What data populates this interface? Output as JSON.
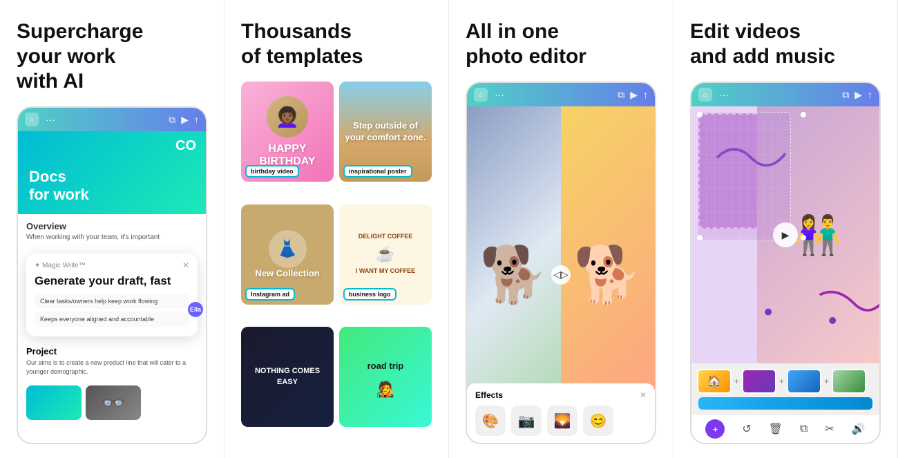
{
  "panel1": {
    "title_line1": "Supercharge",
    "title_line2": "your work",
    "title_line3": "with AI",
    "hero_text": "Docs\nfor work",
    "hero_logo": "CO",
    "overview_title": "Overview",
    "overview_text": "When working with your team, it's important",
    "magic_write_label": "✦ Magic Write™",
    "magic_write_title": "Generate your draft, fast",
    "ella_label": "Ella",
    "suggestion1": "Clear tasks/owners help keep work flowing",
    "suggestion2": "Keeps everyone aligned and accountable",
    "project_title": "Project",
    "project_text": "Our aims is to create a new product line that will cater to a younger demographic."
  },
  "panel2": {
    "title_line1": "Thousands",
    "title_line2": "of templates",
    "templates": [
      {
        "id": "birthday",
        "label": "birthday video",
        "top_text": "HAPPY",
        "bottom_text": "BIRTHDAY"
      },
      {
        "id": "inspirational",
        "label": "inspirational poster",
        "text": "Step outside of your comfort zone."
      },
      {
        "id": "collection",
        "label": "Instagram ad",
        "text": "New Collection"
      },
      {
        "id": "business",
        "label": "business logo",
        "name": "DELIGHT COFFEE",
        "tagline": "I WANT MY COFFEE"
      },
      {
        "id": "nothing",
        "label": "",
        "text": "NOTHING COMES EASY"
      },
      {
        "id": "roadtrip",
        "label": "",
        "text": "road trip"
      }
    ]
  },
  "panel3": {
    "title_line1": "All in one",
    "title_line2": "photo editor",
    "effects_title": "Effects",
    "effects": [
      "🎨",
      "📷",
      "🌄",
      "😊"
    ]
  },
  "panel4": {
    "title_line1": "Edit videos",
    "title_line2": "and add music"
  }
}
